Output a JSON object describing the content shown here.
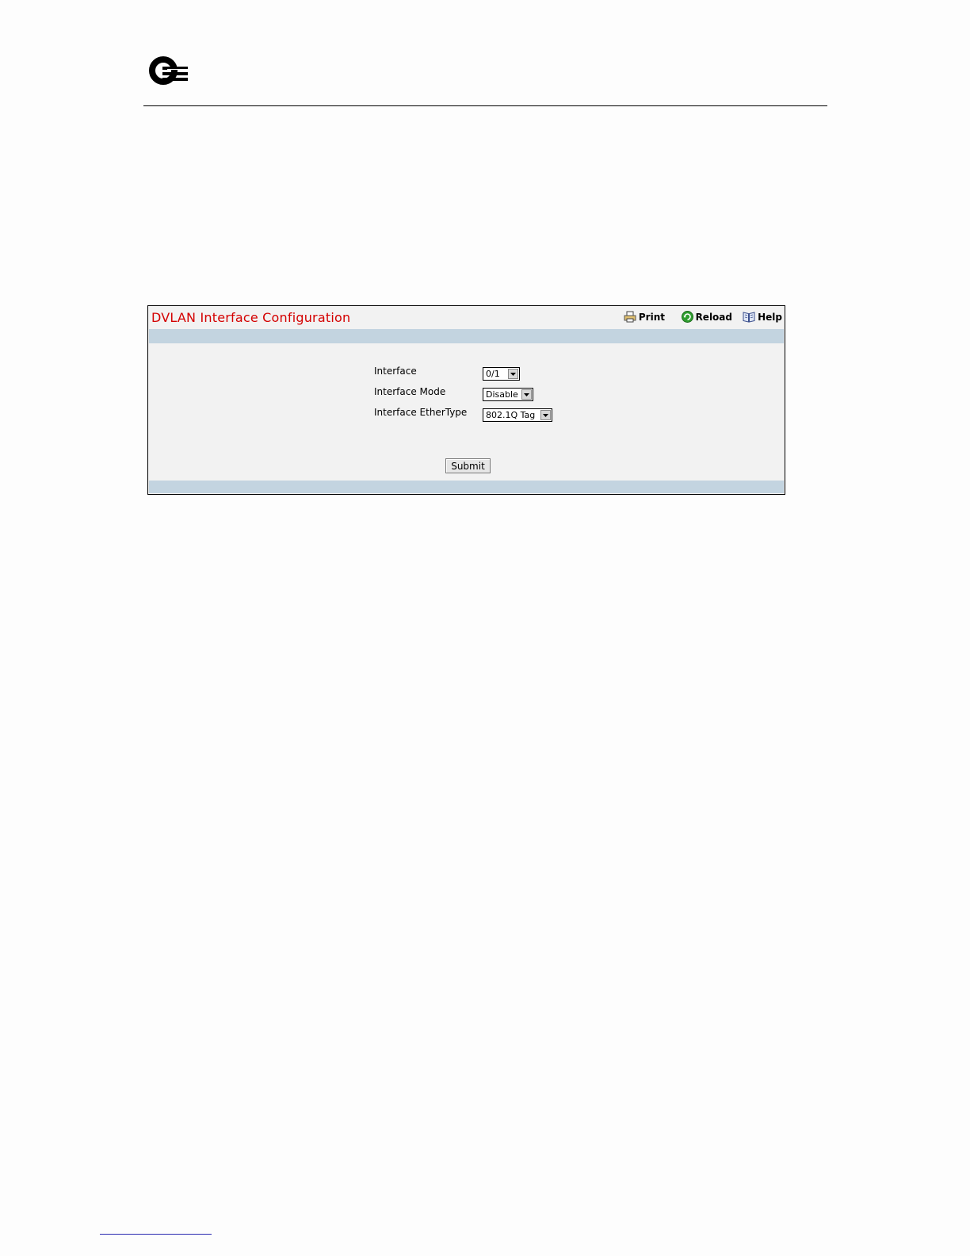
{
  "brand": {
    "logo_icon": "q-logo-icon"
  },
  "panel": {
    "title": "DVLAN Interface Configuration",
    "title_color": "#d40000",
    "band_color": "#c3d4e0",
    "toolbar": {
      "print_label": "Print",
      "reload_label": "Reload",
      "help_label": "Help",
      "print_icon": "printer-icon",
      "reload_icon": "reload-icon",
      "help_icon": "help-book-icon"
    }
  },
  "form": {
    "fields": [
      {
        "label": "Interface",
        "value": "0/1"
      },
      {
        "label": "Interface Mode",
        "value": "Disable"
      },
      {
        "label": "Interface EtherType",
        "value": "802.1Q Tag"
      }
    ],
    "submit_label": "Submit"
  }
}
